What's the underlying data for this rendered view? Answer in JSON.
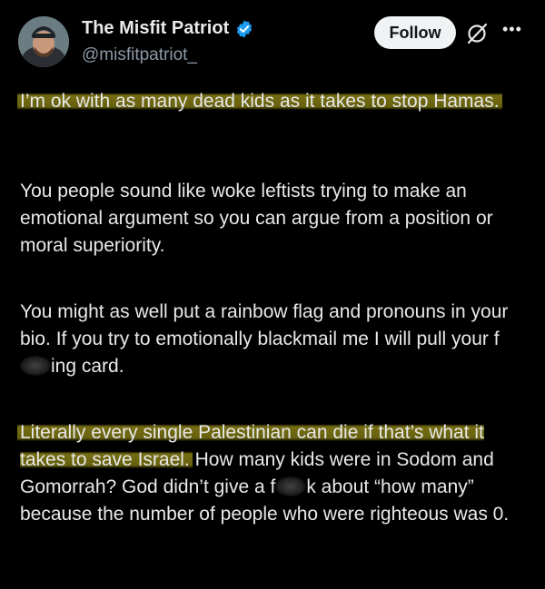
{
  "author": {
    "display_name": "The Misfit Patriot",
    "handle": "@misfitpatriot_",
    "verified_icon": "verified-badge-icon",
    "verified_color": "#1d9bf0"
  },
  "actions": {
    "follow_label": "Follow",
    "grok_icon": "grok-icon",
    "more_icon": "more-options-icon"
  },
  "post": {
    "p1_highlight": "I’m ok with as many dead kids as it takes to stop Hamas.",
    "p2": "You people sound like woke leftists trying to make an emotional argument so you can argue from a position or moral superiority.",
    "p3_before": "You might as well put a rainbow flag and pronouns in your bio. If you try to emotionally blackmail me I will pull your f",
    "p3_after": "ing card.",
    "p4_highlight": "Literally every single Palestinian can die if that’s what it takes to save Israel.",
    "p4_mid": " How many kids were in Sodom and Gomorrah? God didn’t give a f",
    "p4_after": "k about “how many” because the number of people who were righteous was 0."
  },
  "colors": {
    "background": "#000000",
    "text": "#e7e9ea",
    "secondary_text": "#8b98a5",
    "highlight": "#b8aa1e",
    "follow_bg": "#eff3f4"
  }
}
